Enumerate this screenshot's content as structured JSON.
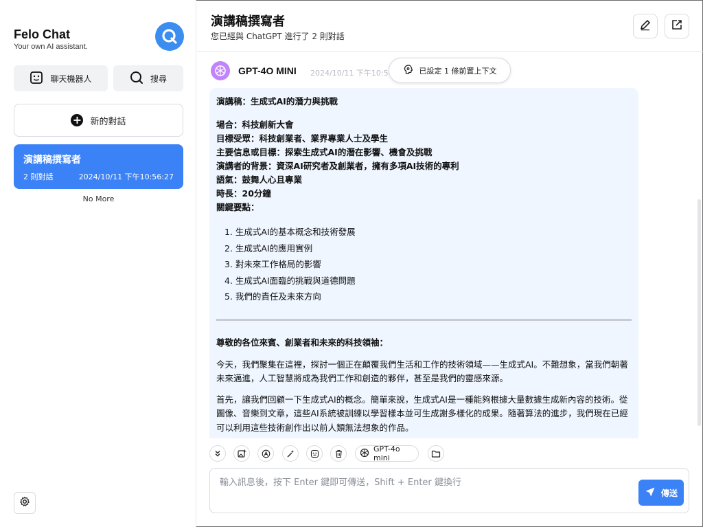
{
  "sidebar": {
    "title": "Felo Chat",
    "subtitle": "Your own AI assistant.",
    "bot_label": "聊天機器人",
    "search_label": "搜尋",
    "new_chat_label": "新的對話",
    "conversations": [
      {
        "title": "演講稿撰寫者",
        "count": "2 則對話",
        "date": "2024/10/11 下午10:56:27"
      }
    ],
    "no_more": "No More"
  },
  "header": {
    "title": "演講稿撰寫者",
    "subtitle": "您已經與 ChatGPT 進行了 2 則對話"
  },
  "message": {
    "model": "GPT-4O MINI",
    "time": "2024/10/11 下午10:56",
    "context_label": "已設定 1 條前置上下文",
    "heading": "演講稿：生成式AI的潛力與挑戰",
    "meta": [
      "場合：科技創新大會",
      "目標受眾：科技創業者、業界專業人士及學生",
      "主要信息或目標：探索生成式AI的潛在影響、機會及挑戰",
      "演講者的背景：資深AI研究者及創業者，擁有多項AI技術的專利",
      "語氣：鼓舞人心且專業",
      "時長：20分鐘",
      "關鍵要點："
    ],
    "points": [
      "1. 生成式AI的基本概念和技術發展",
      "2. 生成式AI的應用實例",
      "3. 對未來工作格局的影響",
      "4. 生成式AI面臨的挑戰與道德問題",
      "5. 我們的責任及未來方向"
    ],
    "greeting": "尊敬的各位來賓、創業者和未來的科技領袖：",
    "para1": "今天，我們聚集在這裡，探討一個正在顛覆我們生活和工作的技術領域——生成式AI。不難想象，當我們朝著未來邁進，人工智慧將成為我們工作和創造的夥伴，甚至是我們的靈感來源。",
    "para2": "首先，讓我們回顧一下生成式AI的概念。簡單來說，生成式AI是一種能夠根據大量數據生成新內容的技術。從圖像、音樂到文章，這些AI系統被訓練以學習樣本並可生成謝多樣化的成果。隨著算法的進步，我們現在已經可以利用這些技術創作出以前人類無法想象的作品。"
  },
  "toolbar": {
    "model_chip": "GPT-4o mini",
    "icons": [
      "chevrons-down-icon",
      "image-add-icon",
      "translate-icon",
      "magic-wand-icon",
      "mask-icon",
      "trash-icon",
      "openai-icon",
      "folder-icon"
    ]
  },
  "input": {
    "placeholder": "輸入訊息後，按下 Enter 鍵即可傳送，Shift + Enter 鍵換行",
    "value": "",
    "send_label": "傳送"
  },
  "colors": {
    "accent": "#3b82f6",
    "logo": "#3b8ef0",
    "bubble": "#eff6ff",
    "avatar": "#c084fc"
  }
}
